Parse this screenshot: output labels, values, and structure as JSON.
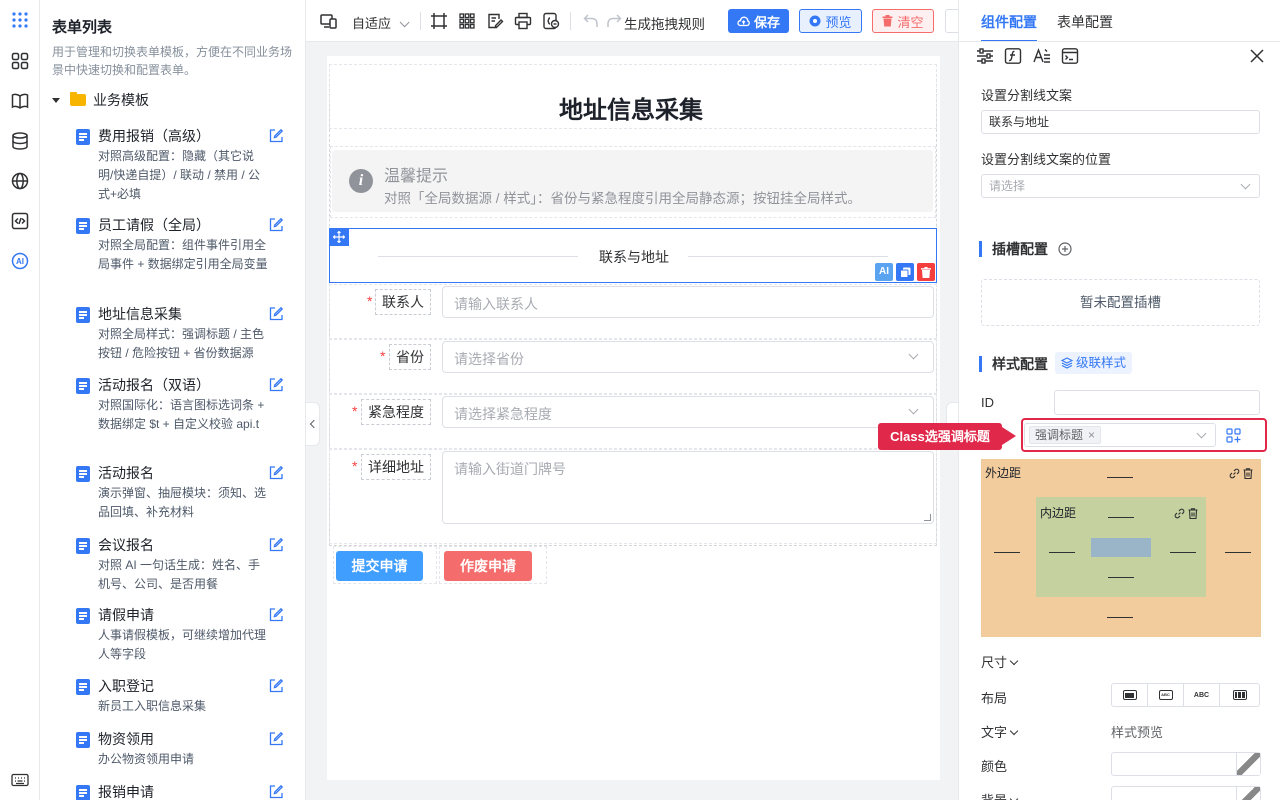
{
  "list": {
    "title": "表单列表",
    "desc": "用于管理和切换表单模板，方便在不同业务场景中快速切换和配置表单。",
    "folder": "业务模板",
    "items": [
      {
        "title": "费用报销（高级）",
        "desc": "对照高级配置：隐藏（其它说明/快递自提）/ 联动 / 禁用 / 公式+必填"
      },
      {
        "title": "员工请假（全局）",
        "desc": "对照全局配置：组件事件引用全局事件 + 数据绑定引用全局变量"
      },
      {
        "title": "地址信息采集",
        "desc": "对照全局样式：强调标题 / 主色按钮 / 危险按钮 + 省份数据源"
      },
      {
        "title": "活动报名（双语）",
        "desc": "对照国际化：语言图标选词条 + 数据绑定 $t + 自定义校验 api.t"
      },
      {
        "title": "活动报名",
        "desc": "演示弹窗、抽屉模块：须知、选品回填、补充材料"
      },
      {
        "title": "会议报名",
        "desc": "对照 AI 一句话生成：姓名、手机号、公司、是否用餐"
      },
      {
        "title": "请假申请",
        "desc": "人事请假模板，可继续增加代理人等字段"
      },
      {
        "title": "入职登记",
        "desc": "新员工入职信息采集"
      },
      {
        "title": "物资领用",
        "desc": "办公物资领用申请"
      },
      {
        "title": "报销申请",
        "desc": ""
      }
    ]
  },
  "toolbar": {
    "adapt": "自适应",
    "rule": "生成拖拽规则",
    "save": "保存",
    "preview": "预览",
    "clear": "清空"
  },
  "form": {
    "title": "地址信息采集",
    "tip_title": "温馨提示",
    "tip_desc": "对照「全局数据源 / 样式」：省份与紧急程度引用全局静态源；按钮挂全局样式。",
    "divider": "联系与地址",
    "fields": [
      {
        "label": "联系人",
        "placeholder": "请输入联系人"
      },
      {
        "label": "省份",
        "placeholder": "请选择省份"
      },
      {
        "label": "紧急程度",
        "placeholder": "请选择紧急程度"
      },
      {
        "label": "详细地址",
        "placeholder": "请输入街道门牌号"
      }
    ],
    "submit": "提交申请",
    "void": "作废申请",
    "ai_badge": "AI"
  },
  "panel": {
    "tab_component": "组件配置",
    "tab_form": "表单配置",
    "divider_text_label": "设置分割线文案",
    "divider_text_value": "联系与地址",
    "divider_pos_label": "设置分割线文案的位置",
    "divider_pos_placeholder": "请选择",
    "slot_title": "插槽配置",
    "slot_empty": "暂未配置插槽",
    "style_title": "样式配置",
    "cascade": "级联样式",
    "id_label": "ID",
    "class_tag": "强调标题",
    "callout": "Class选强调标题",
    "margin": "外边距",
    "padding": "内边距",
    "size": "尺寸",
    "layout": "布局",
    "text": "文字",
    "style_preview": "样式预览",
    "color": "颜色",
    "background": "背景"
  },
  "colors": {
    "primary": "#3478f6",
    "margin_bg": "#f2cc9d",
    "padding_bg": "#c5d29f",
    "content_bg": "#9bb5c8",
    "callout": "#e0284a",
    "danger": "#f56c6c",
    "submit": "#409eff"
  }
}
